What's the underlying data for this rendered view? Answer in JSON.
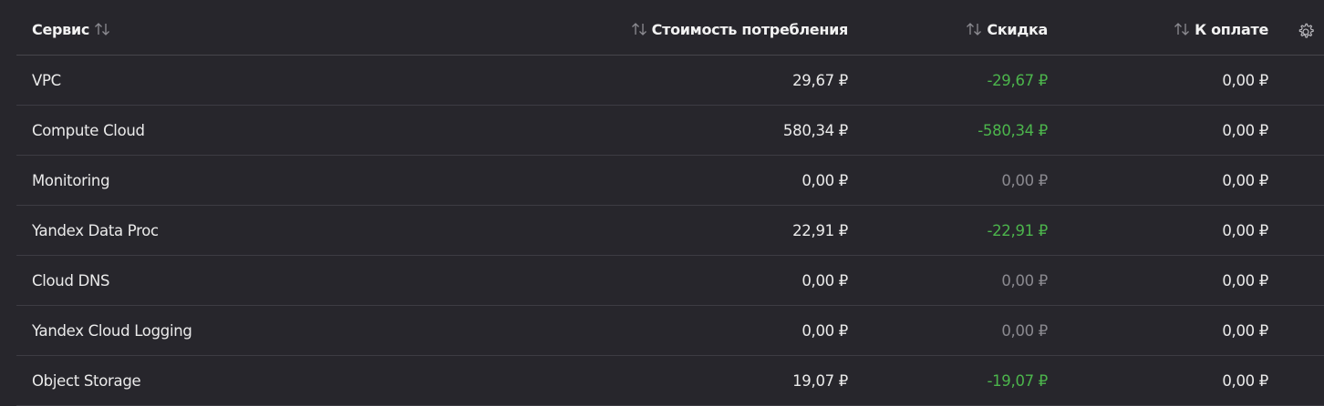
{
  "table": {
    "headers": {
      "service": "Сервис",
      "cost": "Стоимость потребления",
      "discount": "Скидка",
      "to_pay": "К оплате"
    },
    "rows": [
      {
        "service": "VPC",
        "cost": "29,67 ₽",
        "discount": "-29,67 ₽",
        "to_pay": "0,00 ₽"
      },
      {
        "service": "Compute Cloud",
        "cost": "580,34 ₽",
        "discount": "-580,34 ₽",
        "to_pay": "0,00 ₽"
      },
      {
        "service": "Monitoring",
        "cost": "0,00 ₽",
        "discount": "0,00 ₽",
        "to_pay": "0,00 ₽"
      },
      {
        "service": "Yandex Data Proc",
        "cost": "22,91 ₽",
        "discount": "-22,91 ₽",
        "to_pay": "0,00 ₽"
      },
      {
        "service": "Cloud DNS",
        "cost": "0,00 ₽",
        "discount": "0,00 ₽",
        "to_pay": "0,00 ₽"
      },
      {
        "service": "Yandex Cloud Logging",
        "cost": "0,00 ₽",
        "discount": "0,00 ₽",
        "to_pay": "0,00 ₽"
      },
      {
        "service": "Object Storage",
        "cost": "19,07 ₽",
        "discount": "-19,07 ₽",
        "to_pay": "0,00 ₽"
      }
    ]
  },
  "colors": {
    "background": "#27262c",
    "discount_active": "#4cb54c",
    "discount_zero": "#8a898f",
    "text": "#ebebeb"
  },
  "icons": {
    "sort": "sort-arrows-icon",
    "settings": "gear-icon"
  }
}
